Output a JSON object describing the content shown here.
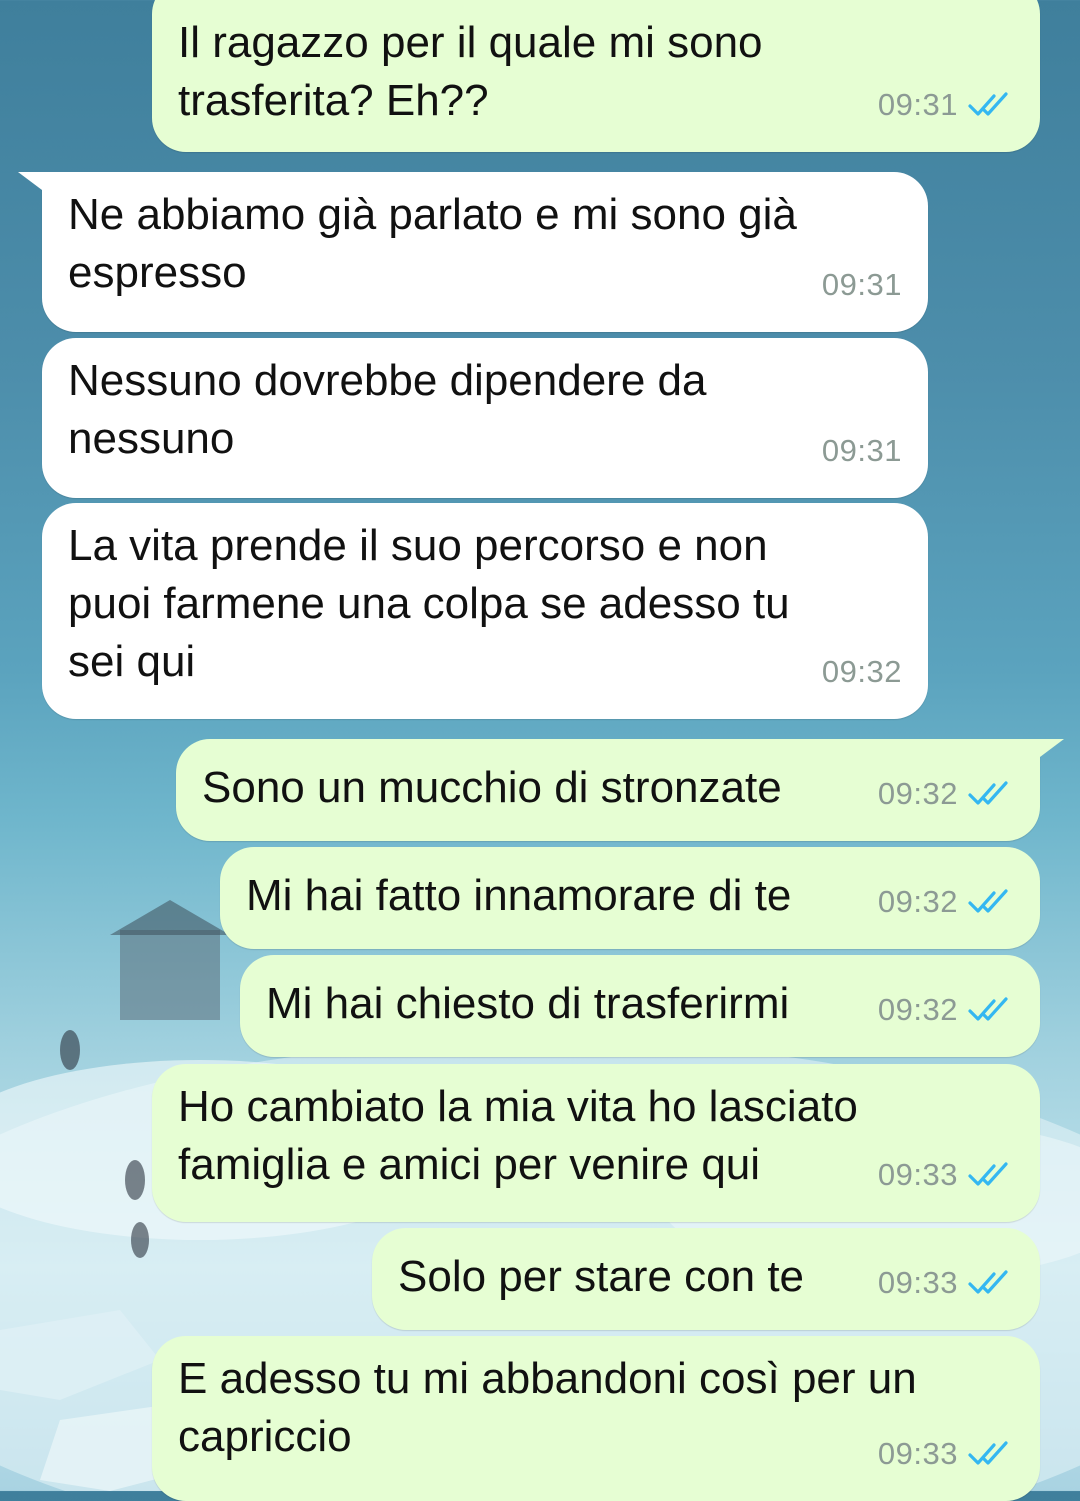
{
  "colors": {
    "outgoing_bubble": "#e6fed3",
    "incoming_bubble": "#ffffff",
    "read_ticks": "#34b7f1",
    "timestamp": "#8c9a94"
  },
  "status_icon": "double-check-read-icon",
  "messages": [
    {
      "direction": "out",
      "text": "Il ragazzo per il quale mi sono\ntrasferita? Eh??",
      "time": "09:31",
      "read": true
    },
    {
      "direction": "in",
      "text": "Ne abbiamo già parlato e mi sono già\nespresso",
      "time": "09:31"
    },
    {
      "direction": "in",
      "text": "Nessuno dovrebbe dipendere da\nnessuno",
      "time": "09:31"
    },
    {
      "direction": "in",
      "text": "La vita prende il suo percorso e non\npuoi farmene una colpa se adesso tu\nsei qui",
      "time": "09:32"
    },
    {
      "direction": "out",
      "text": "Sono un mucchio di stronzate",
      "time": "09:32",
      "read": true
    },
    {
      "direction": "out",
      "text": "Mi hai fatto innamorare di te",
      "time": "09:32",
      "read": true
    },
    {
      "direction": "out",
      "text": "Mi hai chiesto di trasferirmi",
      "time": "09:32",
      "read": true
    },
    {
      "direction": "out",
      "text": "Ho cambiato la mia vita ho lasciato\nfamiglia e amici per venire qui",
      "time": "09:33",
      "read": true
    },
    {
      "direction": "out",
      "text": "Solo per stare con te",
      "time": "09:33",
      "read": true
    },
    {
      "direction": "out",
      "text": "E adesso tu mi abbandoni così per un\ncapriccio",
      "time": "09:33",
      "read": true
    }
  ]
}
